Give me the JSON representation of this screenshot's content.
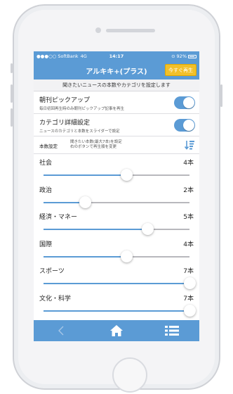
{
  "status_bar": {
    "carrier": "●●●○○ SoftBank",
    "network": "4G",
    "time": "14:17",
    "battery": "92%"
  },
  "nav": {
    "title": "アルキキ+(プラス)",
    "play_now_button": "今すぐ再生"
  },
  "description": "聞きたいニュースの本数やカテゴリを設定します",
  "settings": {
    "morning_pickup": {
      "label": "朝刊ピックアップ",
      "sub": "毎日初回再生時のみ朝刊ピックアップ記事を再生",
      "enabled": true
    },
    "category_detail": {
      "label": "カテゴリ詳細設定",
      "sub": "ニュースのカテゴリと本数をスライダーで設定",
      "enabled": true
    }
  },
  "count_setting": {
    "label": "本数設定",
    "note_line1": "聞きたい本数(最大7本)を設定",
    "note_line2": "右のボタンで再生順を変更",
    "reorder_icon": "sort-order-icon"
  },
  "categories": [
    {
      "name": "社会",
      "count": "4本",
      "value": 4
    },
    {
      "name": "政治",
      "count": "2本",
      "value": 2
    },
    {
      "name": "経済・マネー",
      "count": "5本",
      "value": 5
    },
    {
      "name": "国際",
      "count": "4本",
      "value": 4
    },
    {
      "name": "スポーツ",
      "count": "7本",
      "value": 7
    },
    {
      "name": "文化・科学",
      "count": "7本",
      "value": 7
    }
  ],
  "slider_max": 7,
  "tab_bar": {
    "icons": [
      "back-chevron-icon",
      "home-icon",
      "menu-list-icon"
    ]
  },
  "colors": {
    "accent": "#5b9bd5",
    "button": "#f2c029"
  }
}
